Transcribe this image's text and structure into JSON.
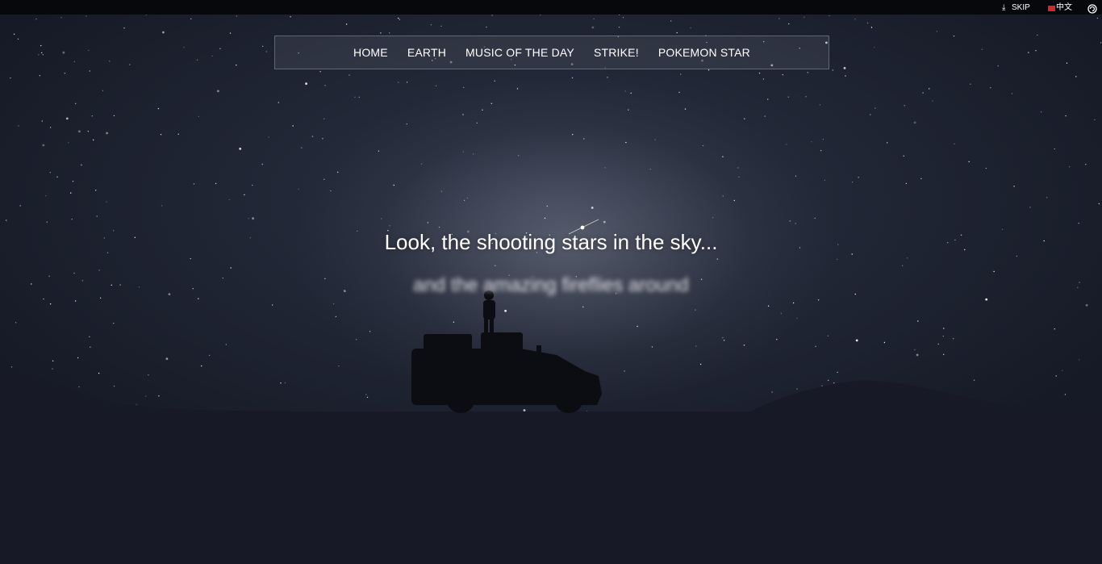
{
  "topbar": {
    "skip_label": "SKIP",
    "lang_label": "中文",
    "flag_color": "#d62728"
  },
  "nav": {
    "items": [
      {
        "label": "HOME"
      },
      {
        "label": "EARTH"
      },
      {
        "label": "MUSIC OF THE DAY"
      },
      {
        "label": "STRIKE!"
      },
      {
        "label": "POKEMON STAR"
      }
    ]
  },
  "hero": {
    "headline": "Look, the shooting stars in the sky...",
    "subline": "and the amazing fireflies around"
  },
  "colors": {
    "sky": "#161a26",
    "ground": "#171a26",
    "text": "#ffffff"
  }
}
